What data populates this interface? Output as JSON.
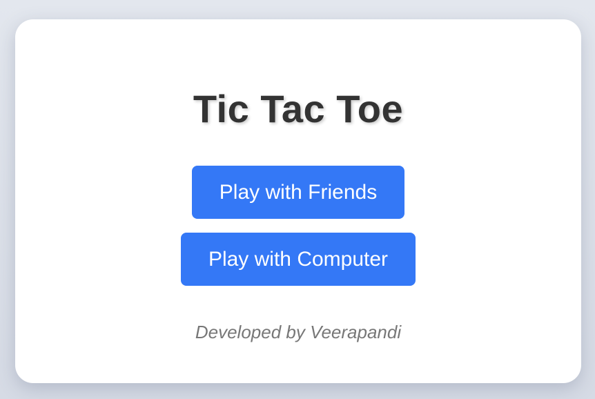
{
  "menu": {
    "title": "Tic Tac Toe",
    "buttons": {
      "friends_label": "Play with Friends",
      "computer_label": "Play with Computer"
    },
    "footer": "Developed by Veerapandi"
  },
  "colors": {
    "accent": "#3478f6",
    "background": "#dde1e9",
    "card": "#ffffff",
    "title": "#333333",
    "footer": "#777777"
  }
}
